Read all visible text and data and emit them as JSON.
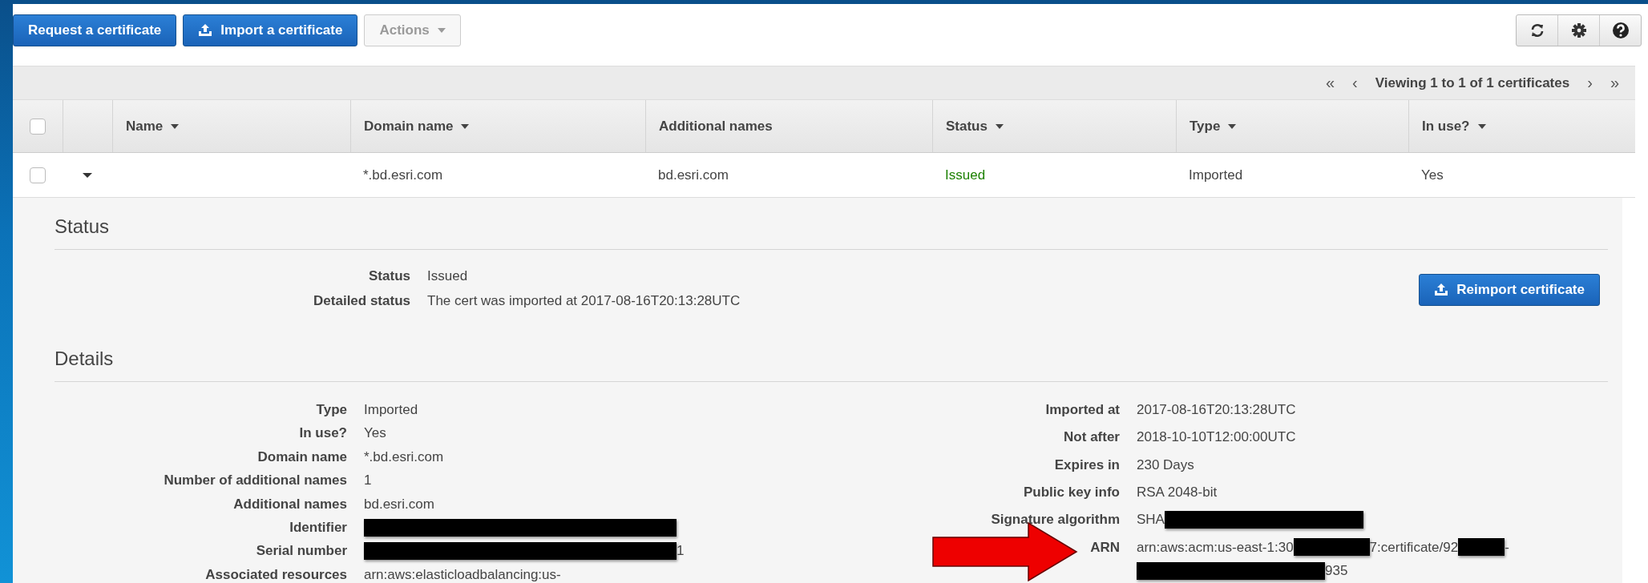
{
  "toolbar": {
    "buttons": [
      {
        "label": "Request a certificate",
        "kind": "primary",
        "disabled": false
      },
      {
        "label": "Import a certificate",
        "kind": "upload",
        "disabled": false
      },
      {
        "label": "Actions",
        "kind": "dropdown",
        "disabled": true
      }
    ],
    "icon_buttons": [
      {
        "kind": "refresh"
      },
      {
        "kind": "settings"
      },
      {
        "kind": "help"
      }
    ]
  },
  "table": {
    "pagination": {
      "first": "«",
      "previous": "‹",
      "summary": "Viewing 1 to 1 of 1 certificates",
      "next": "›",
      "last": "»"
    },
    "header_checkbox": {
      "checked": false
    },
    "columns": [
      {
        "label": "Name",
        "sortable": true
      },
      {
        "label": "Domain name",
        "sortable": true
      },
      {
        "label": "Additional names",
        "sortable": false
      },
      {
        "label": "Status",
        "sortable": true
      },
      {
        "label": "Type",
        "sortable": true
      },
      {
        "label": "In use?",
        "sortable": true
      }
    ],
    "rows": [
      {
        "checked": false,
        "expanded": true,
        "domain_name": "*.bd.esri.com",
        "additional_names": "bd.esri.com",
        "status": {
          "text": "Issued",
          "color": "#1d8102"
        },
        "type": "Imported",
        "in_use": "Yes"
      }
    ]
  },
  "detail": {
    "status_section": {
      "title": "Status",
      "items": [
        {
          "label": "Status",
          "value": "Issued"
        },
        {
          "label": "Detailed status",
          "value": "The cert was imported at 2017-08-16T20:13:28UTC"
        }
      ],
      "button": {
        "label": "Reimport certificate"
      }
    },
    "details_section": {
      "title": "Details",
      "left": [
        {
          "label": "Type",
          "lines": [
            [
              {
                "kind": "text",
                "text": "Imported"
              }
            ]
          ]
        },
        {
          "label": "In use?",
          "lines": [
            [
              {
                "kind": "text",
                "text": "Yes"
              }
            ]
          ]
        },
        {
          "label": "Domain name",
          "lines": [
            [
              {
                "kind": "text",
                "text": "*.bd.esri.com"
              }
            ]
          ]
        },
        {
          "label": "Number of additional names",
          "lines": [
            [
              {
                "kind": "text",
                "text": "1"
              }
            ]
          ]
        },
        {
          "label": "Additional names",
          "lines": [
            [
              {
                "kind": "text",
                "text": "bd.esri.com"
              }
            ]
          ]
        },
        {
          "label": "Identifier",
          "lines": [
            [
              {
                "kind": "redacted"
              }
            ]
          ]
        },
        {
          "label": "Serial number",
          "lines": [
            [
              {
                "kind": "redacted"
              },
              {
                "kind": "text",
                "text": "1"
              }
            ]
          ]
        },
        {
          "label": "Associated resources",
          "lines": [
            [
              {
                "kind": "text",
                "text": "arn:aws:elasticloadbalancing:us-"
              }
            ]
          ]
        }
      ],
      "right": [
        {
          "label": "Imported at",
          "lines": [
            [
              {
                "kind": "text",
                "text": "2017-08-16T20:13:28UTC"
              }
            ]
          ]
        },
        {
          "label": "Not after",
          "lines": [
            [
              {
                "kind": "text",
                "text": "2018-10-10T12:00:00UTC"
              }
            ]
          ]
        },
        {
          "label": "Expires in",
          "lines": [
            [
              {
                "kind": "text",
                "text": "230 Days"
              }
            ]
          ]
        },
        {
          "label": "Public key info",
          "lines": [
            [
              {
                "kind": "text",
                "text": "RSA 2048-bit"
              }
            ]
          ]
        },
        {
          "label": "Signature algorithm",
          "lines": [
            [
              {
                "kind": "text",
                "text": "SHA"
              },
              {
                "kind": "redacted"
              }
            ]
          ]
        },
        {
          "label": "ARN",
          "lines": [
            [
              {
                "kind": "text",
                "text": "arn:aws:acm:us-east-1:30"
              },
              {
                "kind": "redacted"
              },
              {
                "kind": "text",
                "text": "7:certificate/92"
              },
              {
                "kind": "redacted"
              },
              {
                "kind": "text",
                "text": "-"
              }
            ],
            [
              {
                "kind": "redacted"
              },
              {
                "kind": "text",
                "text": "935"
              }
            ]
          ]
        }
      ]
    }
  }
}
